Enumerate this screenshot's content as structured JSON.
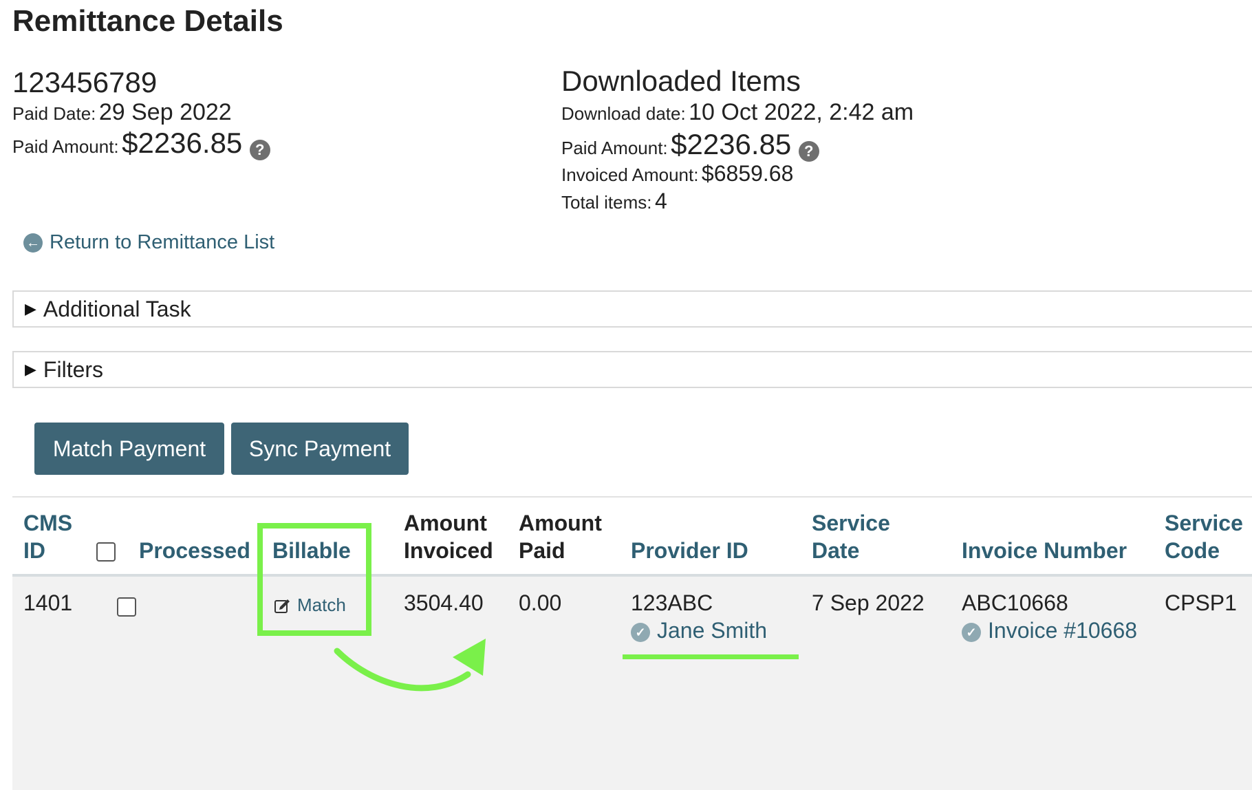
{
  "page": {
    "title": "Remittance Details"
  },
  "remittance": {
    "id": "123456789",
    "paid_date_label": "Paid Date:",
    "paid_date": "29 Sep 2022",
    "paid_amount_label": "Paid Amount:",
    "paid_amount": "$2236.85"
  },
  "downloaded": {
    "title": "Downloaded Items",
    "download_date_label": "Download date:",
    "download_date": "10 Oct 2022, 2:42 am",
    "paid_amount_label": "Paid Amount:",
    "paid_amount": "$2236.85",
    "invoiced_amount_label": "Invoiced Amount:",
    "invoiced_amount": "$6859.68",
    "total_items_label": "Total items:",
    "total_items": "4"
  },
  "help_glyph": "?",
  "nav": {
    "back_label": "Return to Remittance List"
  },
  "sections": {
    "additional_task": "Additional Task",
    "filters": "Filters"
  },
  "actions": {
    "match_payment": "Match Payment",
    "sync_payment": "Sync Payment"
  },
  "table": {
    "headers": {
      "cms_id_1": "CMS",
      "cms_id_2": "ID",
      "processed": "Processed",
      "billable": "Billable",
      "amount_invoiced_1": "Amount",
      "amount_invoiced_2": "Invoiced",
      "amount_paid_1": "Amount",
      "amount_paid_2": "Paid",
      "provider_id": "Provider ID",
      "service_date_1": "Service",
      "service_date_2": "Date",
      "invoice_number": "Invoice Number",
      "service_code_1": "Service",
      "service_code_2": "Code"
    },
    "rows": [
      {
        "cms_id": "1401",
        "billable_action": "Match",
        "amount_invoiced": "3504.40",
        "amount_paid": "0.00",
        "provider_id": "123ABC",
        "provider_name": "Jane Smith",
        "service_date": "7 Sep 2022",
        "invoice_number": "ABC10668",
        "invoice_link": "Invoice #10668",
        "service_code": "CPSP1"
      }
    ]
  },
  "colors": {
    "accent": "#3e6576",
    "link": "#2f5f73",
    "highlight": "#7af04a",
    "row_bg": "#f2f2f2"
  }
}
